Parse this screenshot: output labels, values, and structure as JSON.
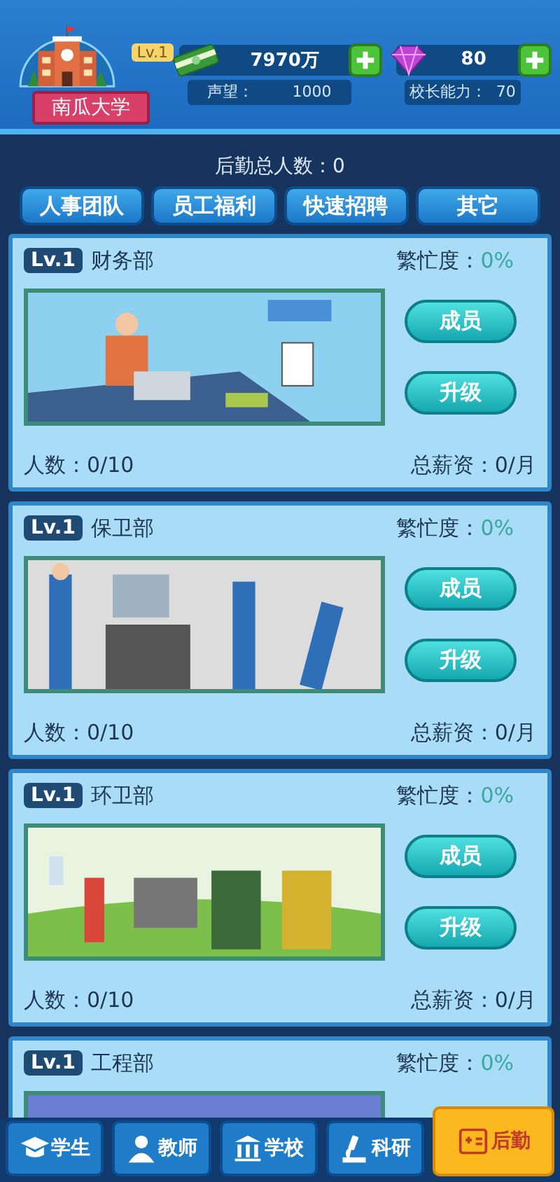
{
  "school": {
    "name": "南瓜大学",
    "level": "Lv.1"
  },
  "money": {
    "value": "7970万"
  },
  "reputation": {
    "label": "声望：",
    "value": "1000"
  },
  "gems": {
    "value": "80"
  },
  "ability": {
    "label": "校长能力：",
    "value": "70"
  },
  "summary": {
    "label": "后勤总人数：",
    "value": "0"
  },
  "tabs": [
    "人事团队",
    "员工福利",
    "快速招聘",
    "其它"
  ],
  "departments": [
    {
      "level": "Lv.1",
      "name": "财务部",
      "busy_label": "繁忙度：",
      "busy": "0%",
      "buttons": [
        "成员",
        "升级"
      ],
      "headcount_label": "人数：",
      "headcount": "0/10",
      "salary_label": "总薪资：",
      "salary": "0/月"
    },
    {
      "level": "Lv.1",
      "name": "保卫部",
      "busy_label": "繁忙度：",
      "busy": "0%",
      "buttons": [
        "成员",
        "升级"
      ],
      "headcount_label": "人数：",
      "headcount": "0/10",
      "salary_label": "总薪资：",
      "salary": "0/月"
    },
    {
      "level": "Lv.1",
      "name": "环卫部",
      "busy_label": "繁忙度：",
      "busy": "0%",
      "buttons": [
        "成员",
        "升级"
      ],
      "headcount_label": "人数：",
      "headcount": "0/10",
      "salary_label": "总薪资：",
      "salary": "0/月"
    },
    {
      "level": "Lv.1",
      "name": "工程部",
      "busy_label": "繁忙度：",
      "busy": "0%"
    }
  ],
  "nav": [
    {
      "label": "学生",
      "selected": false
    },
    {
      "label": "教师",
      "selected": false
    },
    {
      "label": "学校",
      "selected": false
    },
    {
      "label": "科研",
      "selected": false
    },
    {
      "label": "后勤",
      "selected": true
    }
  ]
}
